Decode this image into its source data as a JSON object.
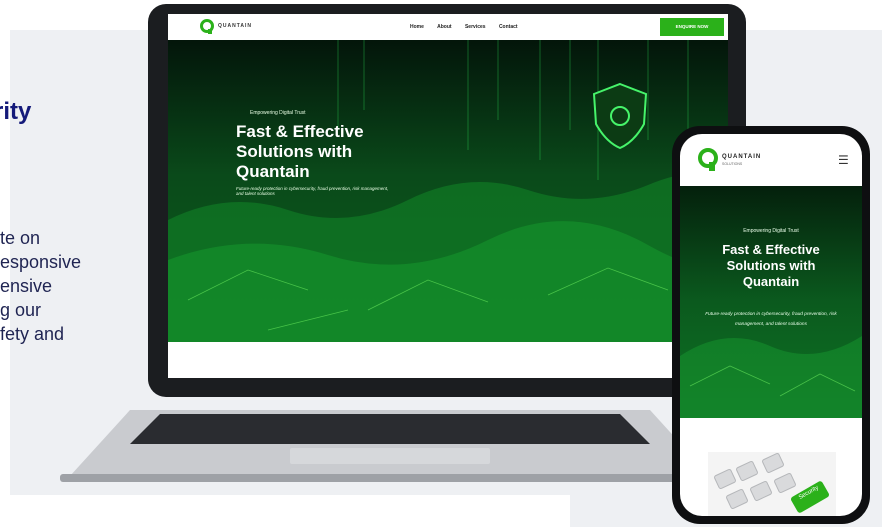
{
  "left_copy": {
    "heading": "rity",
    "paragraph_lines": [
      "te on",
      "esponsive",
      "ensive",
      "g our",
      "fety and"
    ]
  },
  "laptop_site": {
    "logo_text": "QUANTAIN",
    "nav": [
      "Home",
      "About",
      "Services",
      "Contact"
    ],
    "cta": "ENQUIRE NOW",
    "tagline": "Empowering Digital Trust",
    "title_lines": [
      "Fast & Effective",
      "Solutions with",
      "Quantain"
    ],
    "subtitle": "Future-ready protection in cybersecurity, fraud prevention, risk management, and talent solutions"
  },
  "phone_site": {
    "logo_text": "QUANTAIN",
    "logo_sub": "SOLUTIONS",
    "tagline": "Empowering Digital Trust",
    "title_lines": [
      "Fast & Effective",
      "Solutions with",
      "Quantain"
    ],
    "subtitle": "Future-ready protection in cybersecurity, fraud prevention, risk management, and talent solutions",
    "image_key_label": "Security"
  },
  "colors": {
    "heading": "#141a7a",
    "brand_green": "#2bb11a",
    "bg_panel": "#eef0f3"
  },
  "icons": [
    "hamburger-menu-icon",
    "shield-lock-icon",
    "quantain-q-logo"
  ]
}
